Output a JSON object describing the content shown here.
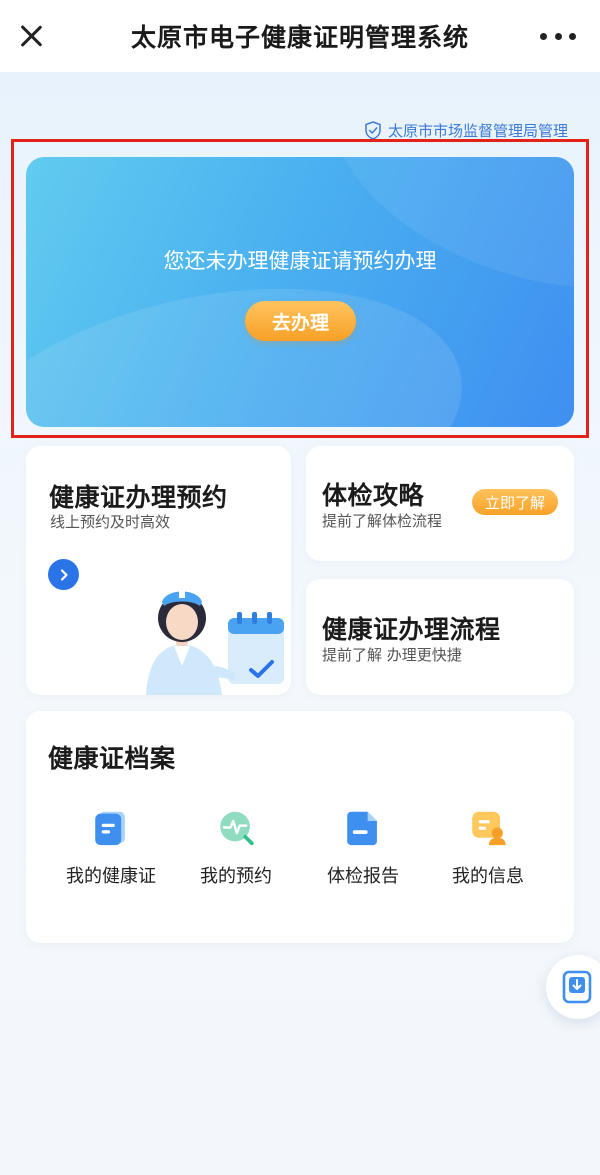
{
  "header": {
    "title": "太原市电子健康证明管理系统"
  },
  "authority": {
    "text": "太原市市场监督管理局管理"
  },
  "banner": {
    "message": "您还未办理健康证请预约办理",
    "button_label": "去办理"
  },
  "cards": {
    "appointment": {
      "title": "健康证办理预约",
      "subtitle": "线上预约及时高效"
    },
    "guide": {
      "title": "体检攻略",
      "subtitle": "提前了解体检流程",
      "button_label": "立即了解"
    },
    "process": {
      "title": "健康证办理流程",
      "subtitle": "提前了解 办理更快捷"
    }
  },
  "archive": {
    "title": "健康证档案",
    "items": [
      {
        "label": "我的健康证",
        "icon": "health-cert-icon"
      },
      {
        "label": "我的预约",
        "icon": "appointment-search-icon"
      },
      {
        "label": "体检报告",
        "icon": "report-icon"
      },
      {
        "label": "我的信息",
        "icon": "user-info-icon"
      }
    ]
  },
  "colors": {
    "accent_blue": "#2a74e8",
    "banner_blue": "#4ab0f0",
    "accent_orange": "#f7a027",
    "highlight_red": "#e2231a"
  }
}
